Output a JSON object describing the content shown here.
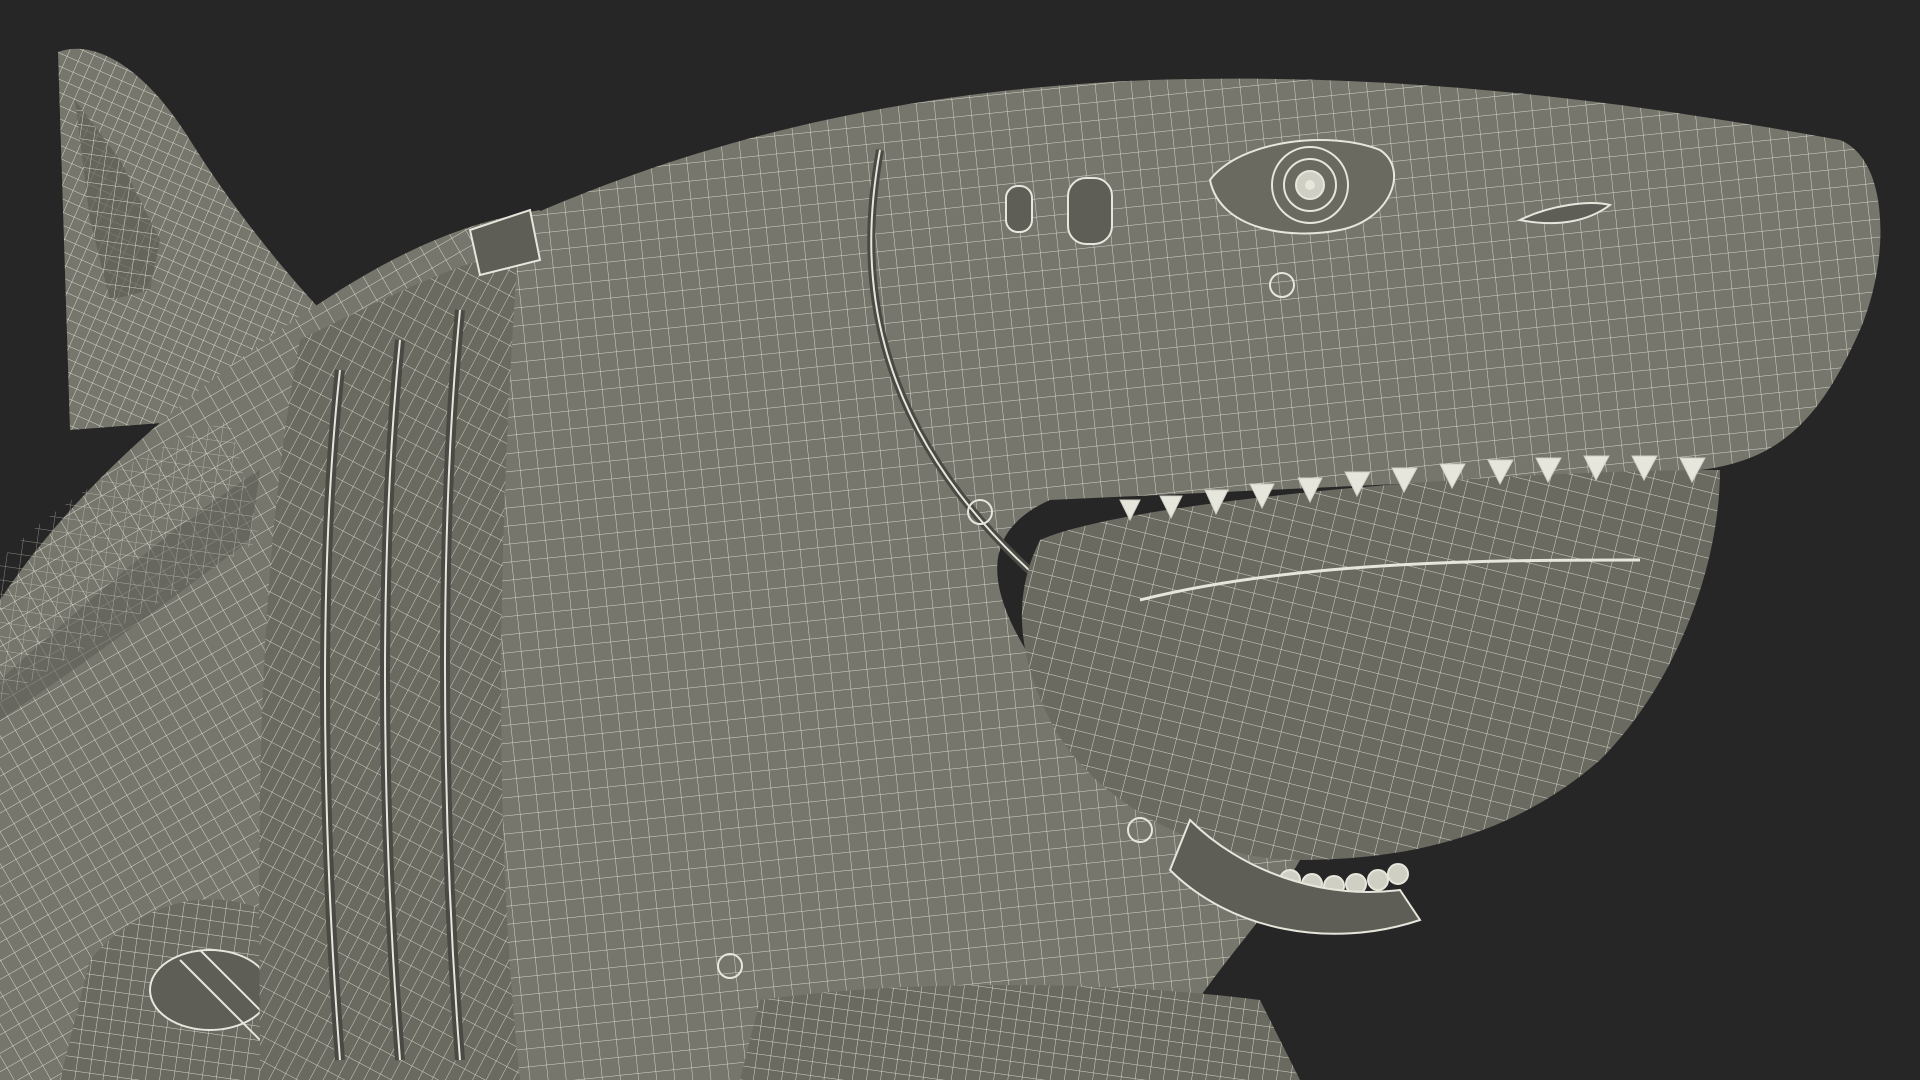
{
  "scene": {
    "subject": "robotic-shark-wireframe",
    "colors": {
      "background": "#262626",
      "surface": "#76766c",
      "surface_dark": "#5e5e56",
      "surface_shadow": "#4a4a44",
      "wire": "#e6e6dc",
      "wire_soft": "#cfcfc4"
    }
  }
}
